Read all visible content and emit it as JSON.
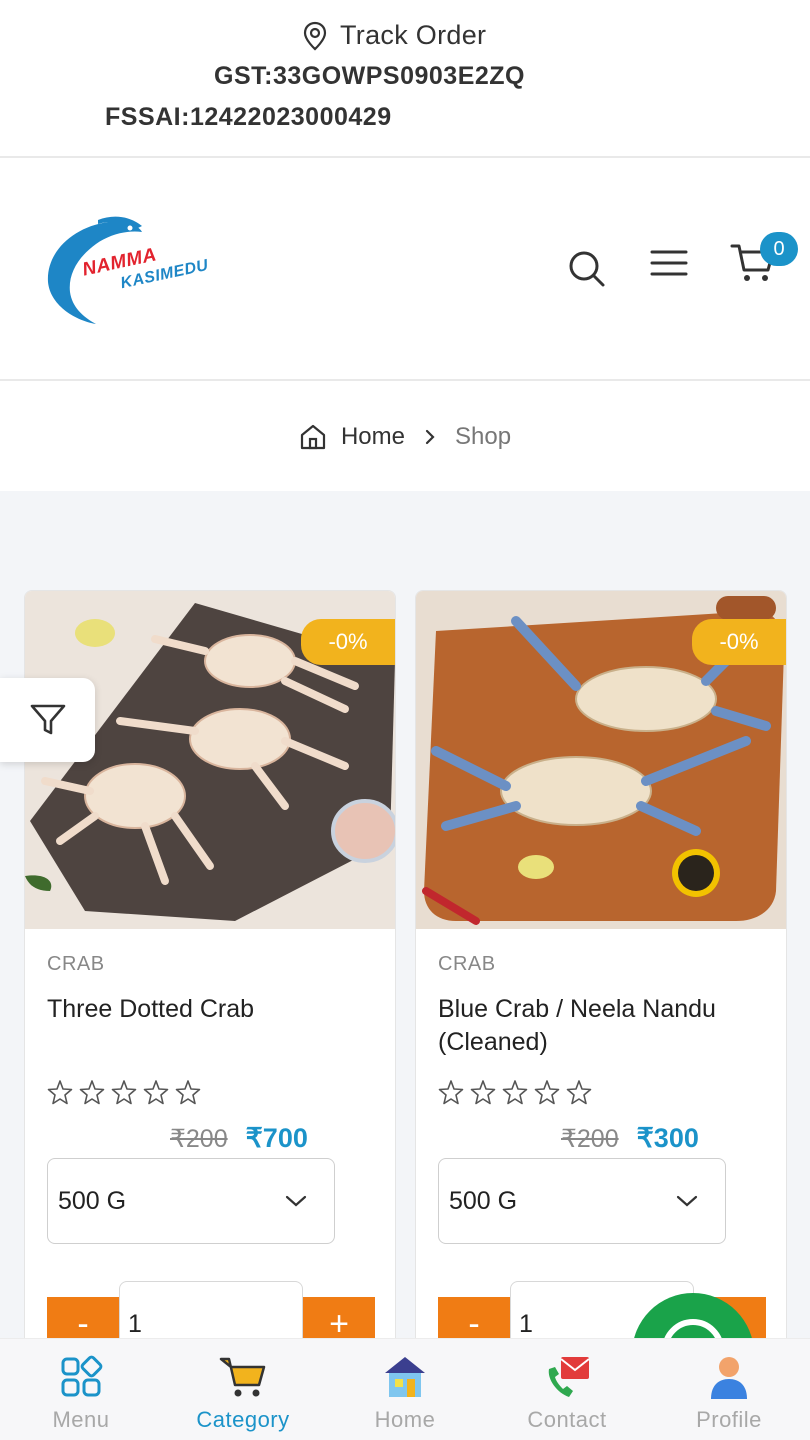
{
  "topbar": {
    "track_label": "Track Order",
    "gst": "GST:33GOWPS0903E2ZQ",
    "fssai": "FSSAI:12422023000429"
  },
  "header": {
    "logo_line1": "NAMMA",
    "logo_line2": "KASIMEDU",
    "cart_count": "0"
  },
  "breadcrumb": {
    "home": "Home",
    "current": "Shop"
  },
  "products": [
    {
      "category": "CRAB",
      "name": "Three Dotted Crab",
      "discount": "-0%",
      "old_price": "₹200",
      "price": "₹700",
      "weight": "500 G",
      "quantity": "1",
      "rating": 0
    },
    {
      "category": "CRAB",
      "name": "Blue Crab / Neela Nandu (Cleaned)",
      "discount": "-0%",
      "old_price": "₹200",
      "price": "₹300",
      "weight": "500 G",
      "quantity": "1",
      "rating": 0
    }
  ],
  "qty_controls": {
    "minus": "-",
    "plus": "+"
  },
  "bottom_nav": [
    {
      "label": "Menu",
      "icon": "grid-icon",
      "active": false
    },
    {
      "label": "Category",
      "icon": "cart-icon",
      "active": true
    },
    {
      "label": "Home",
      "icon": "house-icon",
      "active": false
    },
    {
      "label": "Contact",
      "icon": "phone-mail-icon",
      "active": false
    },
    {
      "label": "Profile",
      "icon": "user-icon",
      "active": false
    }
  ],
  "colors": {
    "accent": "#1b93c9",
    "discount": "#f2b31d",
    "qty_button": "#f07c14",
    "whatsapp": "#1aa34a"
  }
}
